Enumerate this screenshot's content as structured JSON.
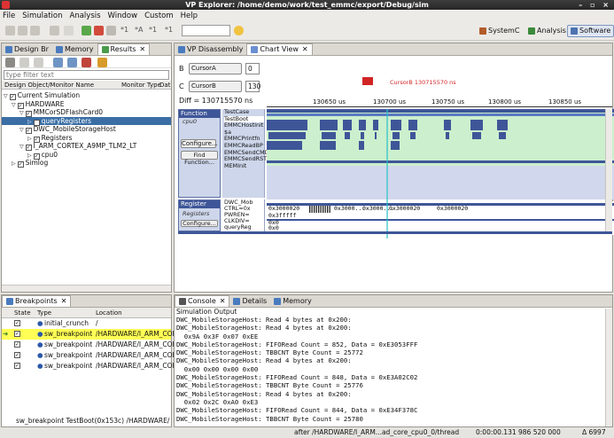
{
  "window": {
    "title": "VP Explorer: /home/demo/work/test_emmc/export/Debug/sim",
    "controls": "– ▫ ×"
  },
  "menu": [
    "File",
    "Simulation",
    "Analysis",
    "Window",
    "Custom",
    "Help"
  ],
  "toolbar": {
    "t1": "*1",
    "t2": "*A",
    "t3": "*1",
    "t4": "*1",
    "perspectives": [
      "SystemC",
      "Analysis",
      "Software"
    ]
  },
  "left_tabs": [
    "Design Br",
    "Memory",
    "Results"
  ],
  "filter": {
    "placeholder": "type filter text"
  },
  "design_headers": [
    "Design Object/Monitor Name",
    "Monitor Type",
    "Dat"
  ],
  "tree": [
    {
      "label": "Current Simulation",
      "indent": 0,
      "tw": "▽",
      "cb": "✓"
    },
    {
      "label": "HARDWARE",
      "indent": 1,
      "tw": "▽",
      "cb": "✓"
    },
    {
      "label": "MMCorSDFlashCard0",
      "indent": 2,
      "tw": "▽",
      "cb": "✓"
    },
    {
      "label": "queryRegisters",
      "indent": 3,
      "tw": "▷",
      "cb": "✓",
      "selected": true
    },
    {
      "label": "DWC_MobileStorageHost",
      "indent": 2,
      "tw": "▽",
      "cb": "✓"
    },
    {
      "label": "Registers",
      "indent": 3,
      "tw": "▷",
      "cb": "✓"
    },
    {
      "label": "I_ARM_CORTEX_A9MP_TLM2_LT",
      "indent": 2,
      "tw": "▽",
      "cb": "✓"
    },
    {
      "label": "cpu0",
      "indent": 3,
      "tw": "▷",
      "cb": "✓"
    },
    {
      "label": "Simlog",
      "indent": 1,
      "tw": "▷",
      "cb": "✓"
    }
  ],
  "breakpoints": {
    "tab": "Breakpoints",
    "headers": [
      "State",
      "Type",
      "Location"
    ],
    "rows": [
      {
        "type": "initial_crunch",
        "loc": "/",
        "highlight": false
      },
      {
        "type": "sw_breakpoint",
        "loc": "/HARDWARE/I_ARM_COI",
        "highlight": true
      },
      {
        "type": "sw_breakpoint",
        "loc": "/HARDWARE/I_ARM_COI",
        "highlight": false
      },
      {
        "type": "sw_breakpoint",
        "loc": "/HARDWARE/I_ARM_COI",
        "highlight": false
      },
      {
        "type": "sw_breakpoint",
        "loc": "/HARDWARE/I_ARM_COI",
        "highlight": false
      }
    ],
    "footer": "sw_breakpoint TestBoot(0x153c) /HARDWARE/"
  },
  "center_tabs": [
    "VP Disassembly",
    "Chart View"
  ],
  "chart": {
    "cursorB": {
      "label": "B",
      "value": "CursorA",
      "num": "0"
    },
    "cursorC": {
      "label": "C",
      "value": "CursorB",
      "num": "130"
    },
    "diff": "Diff = 130715570 ns",
    "marker": "CursorB 130715570 ns",
    "ticks": [
      "130650 us",
      "130700 us",
      "130750 us",
      "130800 us",
      "130850 us"
    ],
    "function_panel": {
      "title": "Function",
      "sub": "cpu0",
      "configure": "Configure...",
      "find": "Find Function..."
    },
    "function_list": [
      "TestCase",
      "TestBoot",
      "EMMCHostInit",
      "$a",
      "EMMCPrintfn",
      "EMMCReadBP",
      "EMMCSendCMD",
      "EMMCSendRST",
      "MEMInit"
    ],
    "register_panel": {
      "title": "Register",
      "sub": "Registers",
      "configure": "Configure..."
    },
    "register_list": [
      "DWC_Mob",
      "CTRL=0x",
      "PWREN=",
      "CLKDIV=",
      "queryReg"
    ],
    "register_values": [
      "0x3000020",
      "0x3000...",
      "0x3000...",
      "0x3000020",
      "0x3000020",
      "0x3fffff",
      "0x0",
      "0x0"
    ]
  },
  "console": {
    "tabs": [
      "Console",
      "Details",
      "Memory"
    ],
    "label": "Simulation Output",
    "lines": [
      "DWC_MobileStorageHost: Read 4 bytes at 0x200:",
      "DWC_MobileStorageHost: Read 4 bytes at 0x200:",
      "  0x9A 0x3F 0x07 0xEE",
      "DWC_MobileStorageHost: FIFORead Count = 852, Data = 0xE3053FFF",
      "DWC_MobileStorageHost: TBBCNT Byte Count = 25772",
      "DWC_MobileStorageHost: Read 4 bytes at 0x200:",
      "  0x00 0x00 0x00 0x00",
      "DWC_MobileStorageHost: FIFORead Count = 848, Data = 0xE3A02C02",
      "DWC_MobileStorageHost: TBBCNT Byte Count = 25776",
      "DWC_MobileStorageHost: Read 4 bytes at 0x200:",
      "  0x02 0x2C 0xA0 0xE3",
      "DWC_MobileStorageHost: FIFORead Count = 844, Data = 0xE34F378C",
      "DWC_MobileStorageHost: TBBCNT Byte Count = 25780"
    ]
  },
  "status": {
    "left": "after /HARDWARE/I_ARM...ad_core_cpu0_0/thread",
    "time": "0:00:00.131 986 520 000",
    "delta": "Δ 6997"
  }
}
